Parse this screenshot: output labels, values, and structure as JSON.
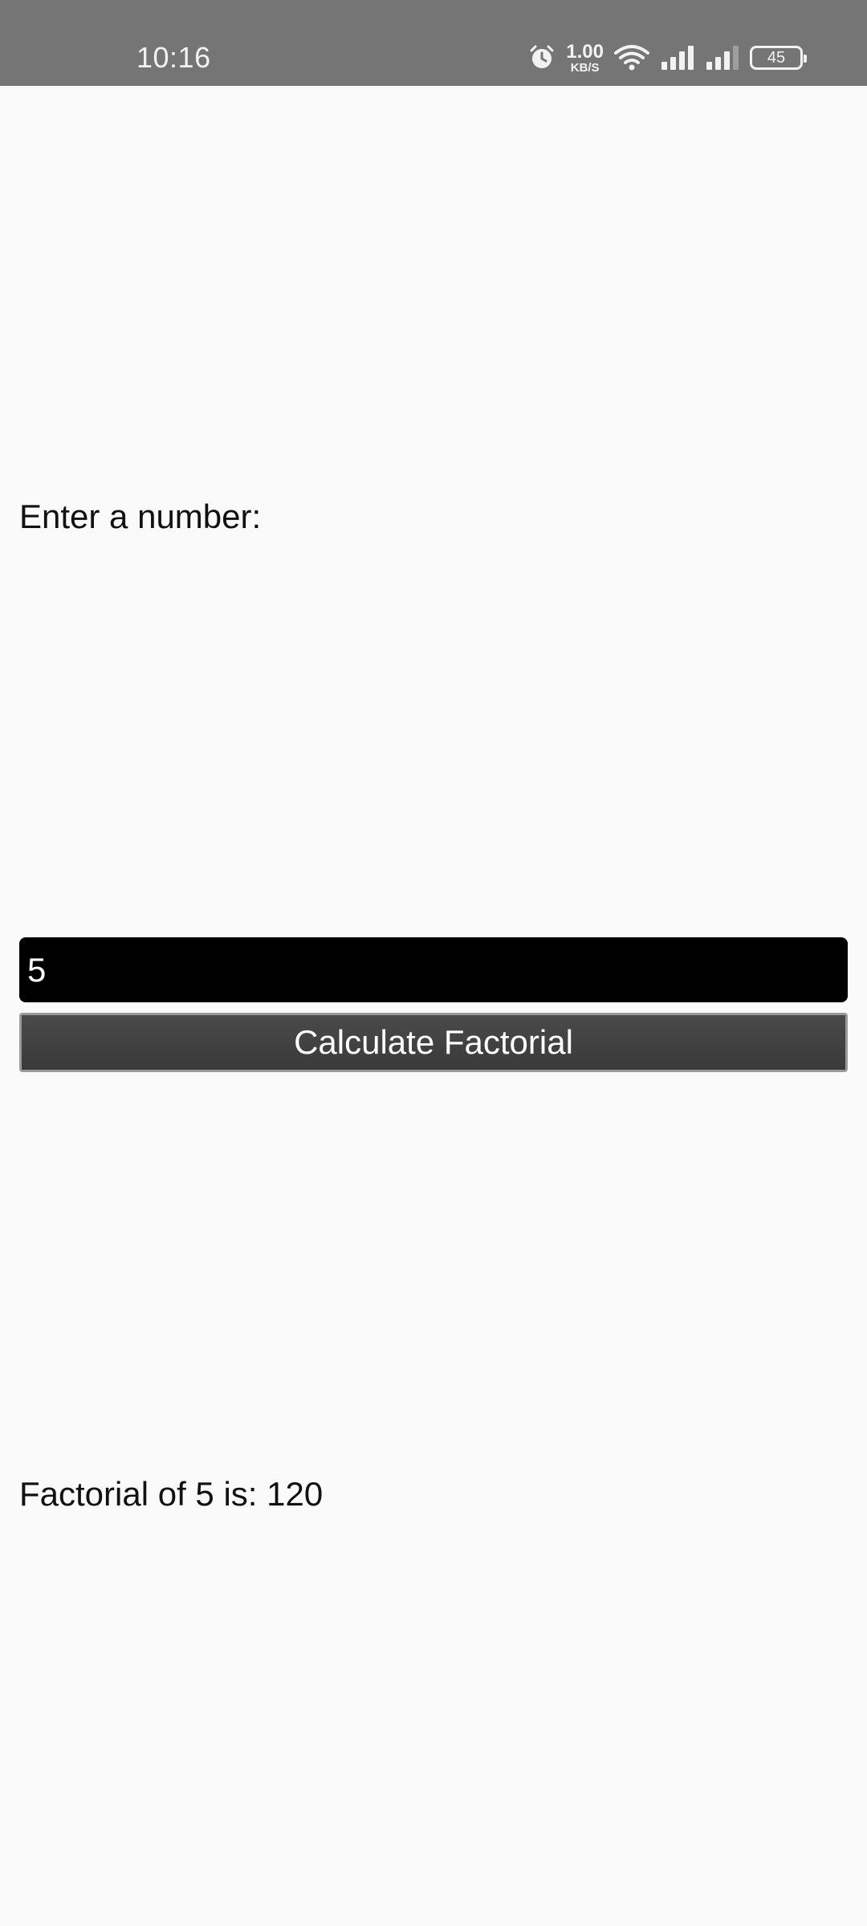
{
  "status_bar": {
    "time": "10:16",
    "net_speed_value": "1.00",
    "net_speed_unit": "KB/S",
    "battery_level": "45",
    "icons": [
      "alarm-icon",
      "wifi-icon",
      "signal-icon",
      "signal-icon-2",
      "battery-icon"
    ]
  },
  "main": {
    "prompt_label": "Enter a number:",
    "number_input_value": "5",
    "calculate_button_label": "Calculate Factorial",
    "result_text": "Factorial of 5 is: 120"
  },
  "colors": {
    "status_bar_bg": "#757575",
    "page_bg": "#fafafa",
    "input_bg": "#000000",
    "button_bg": "#424242"
  }
}
